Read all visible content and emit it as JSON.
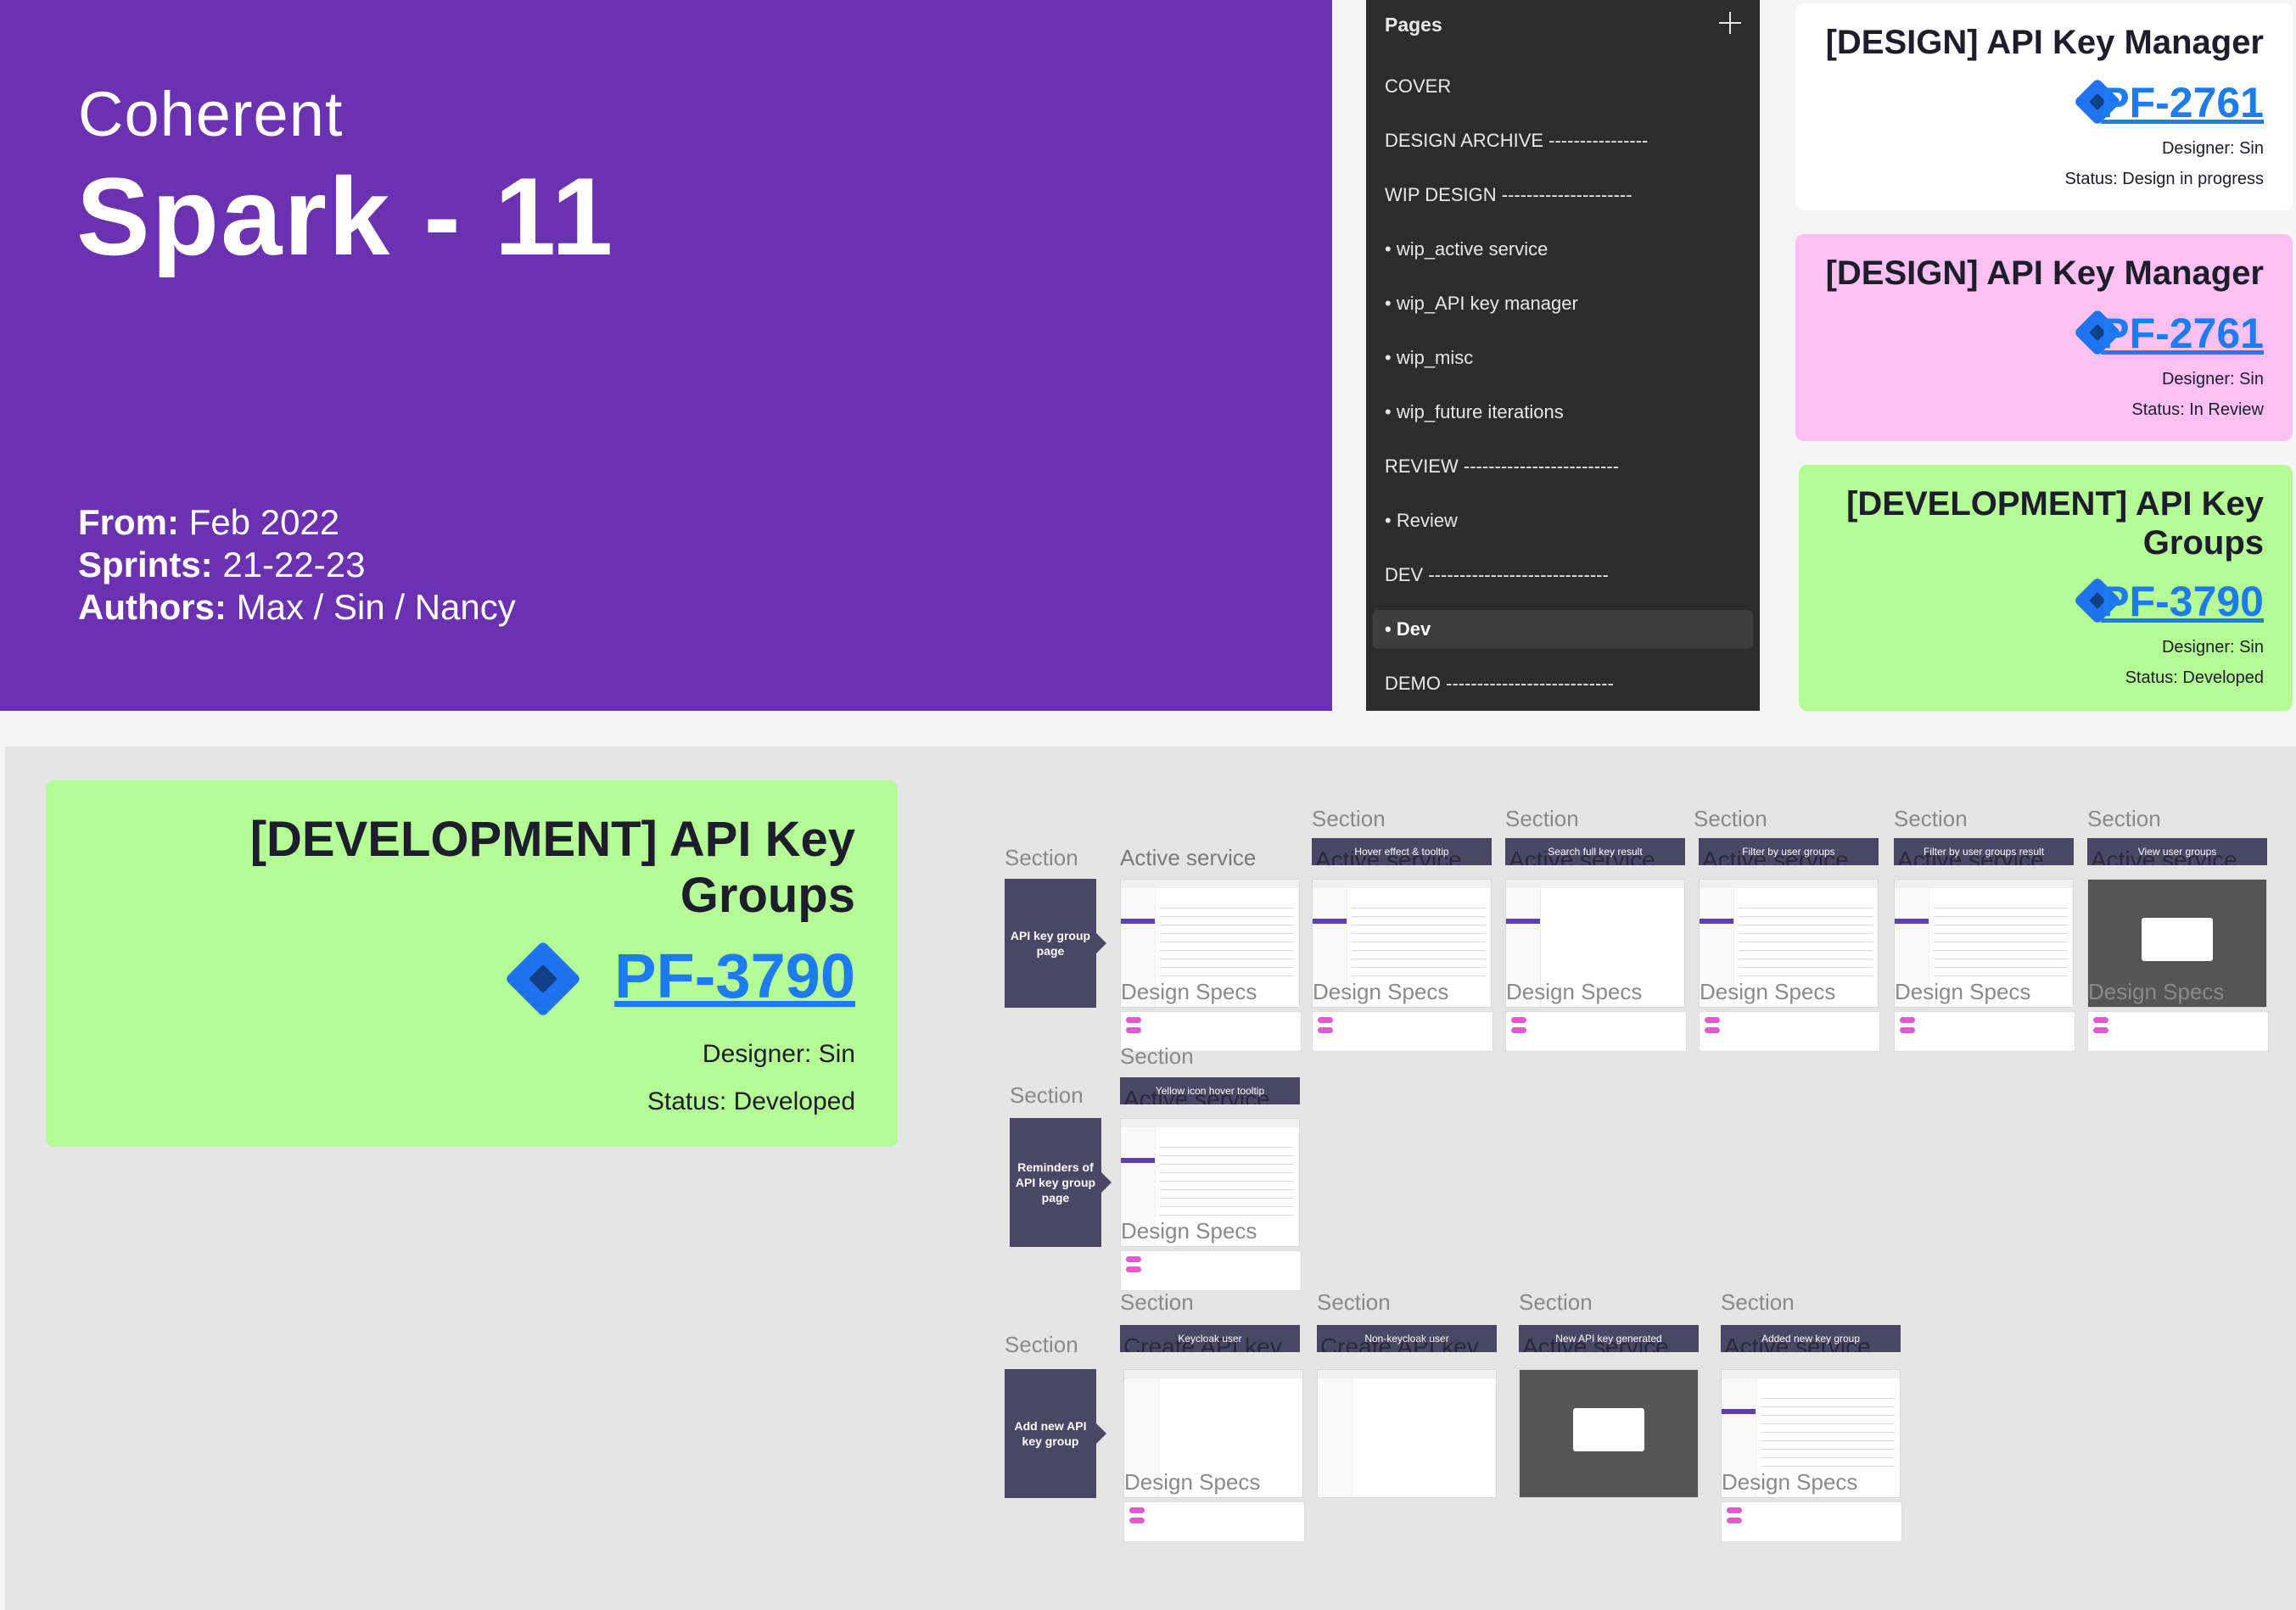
{
  "cover": {
    "brand": "Coherent",
    "title": "Spark - 11",
    "from_label": "From:",
    "from_value": "Feb 2022",
    "sprints_label": "Sprints:",
    "sprints_value": "21-22-23",
    "authors_label": "Authors:",
    "authors_value": "Max / Sin / Nancy"
  },
  "pages_panel": {
    "title": "Pages",
    "items": [
      {
        "label": "COVER"
      },
      {
        "label": "DESIGN ARCHIVE ----------------"
      },
      {
        "label": "WIP DESIGN ---------------------"
      },
      {
        "label": "• wip_active service"
      },
      {
        "label": "• wip_API key manager"
      },
      {
        "label": "• wip_misc"
      },
      {
        "label": "• wip_future iterations"
      },
      {
        "label": "REVIEW -------------------------"
      },
      {
        "label": "• Review"
      },
      {
        "label": "DEV -----------------------------"
      },
      {
        "label": "• Dev",
        "active": true
      },
      {
        "label": "DEMO ---------------------------"
      }
    ]
  },
  "cards": [
    {
      "title": "[DESIGN] API Key Manager",
      "ticket": "PF-2761",
      "designer": "Designer: Sin",
      "status": "Status: Design in progress",
      "bg": "#ffffff"
    },
    {
      "title": "[DESIGN] API Key Manager",
      "ticket": "PF-2761",
      "designer": "Designer: Sin",
      "status": "Status: In Review",
      "bg": "#fcc1f2"
    },
    {
      "title_line1": "[DEVELOPMENT] API Key",
      "title_line2": "Groups",
      "ticket": "PF-3790",
      "designer": "Designer: Sin",
      "status": "Status: Developed",
      "bg": "#b5fb96"
    }
  ],
  "big_card": {
    "title_line1": "[DEVELOPMENT] API Key",
    "title_line2": "Groups",
    "ticket": "PF-3790",
    "designer": "Designer: Sin",
    "status": "Status: Developed",
    "bg": "#b5fb96"
  },
  "canvas": {
    "section_word": "Section",
    "design_specs": "Design Specs",
    "row1": {
      "label": "API key group page",
      "first_title": "Active service",
      "frames": [
        {
          "caption": "",
          "ghost": ""
        },
        {
          "caption": "Hover effect & tooltip",
          "ghost": "Active service"
        },
        {
          "caption": "Search full key result",
          "ghost": "Active service"
        },
        {
          "caption": "Filter by user groups",
          "ghost": "Active service"
        },
        {
          "caption": "Filter by user groups result",
          "ghost": "Active service"
        },
        {
          "caption": "View user groups",
          "ghost": "Active service"
        }
      ]
    },
    "row2": {
      "label": "Reminders of API key group page",
      "frames": [
        {
          "caption": "Yellow icon hover tooltip",
          "ghost": "Active service"
        }
      ]
    },
    "row3": {
      "label": "Add new API key group",
      "frames": [
        {
          "caption": "Keycloak user",
          "ghost": "Create API key"
        },
        {
          "caption": "Non-keycloak user",
          "ghost": "Create API key"
        },
        {
          "caption": "New API key generated",
          "ghost": "Active service"
        },
        {
          "caption": "Added new key group",
          "ghost": "Active service"
        }
      ]
    }
  }
}
